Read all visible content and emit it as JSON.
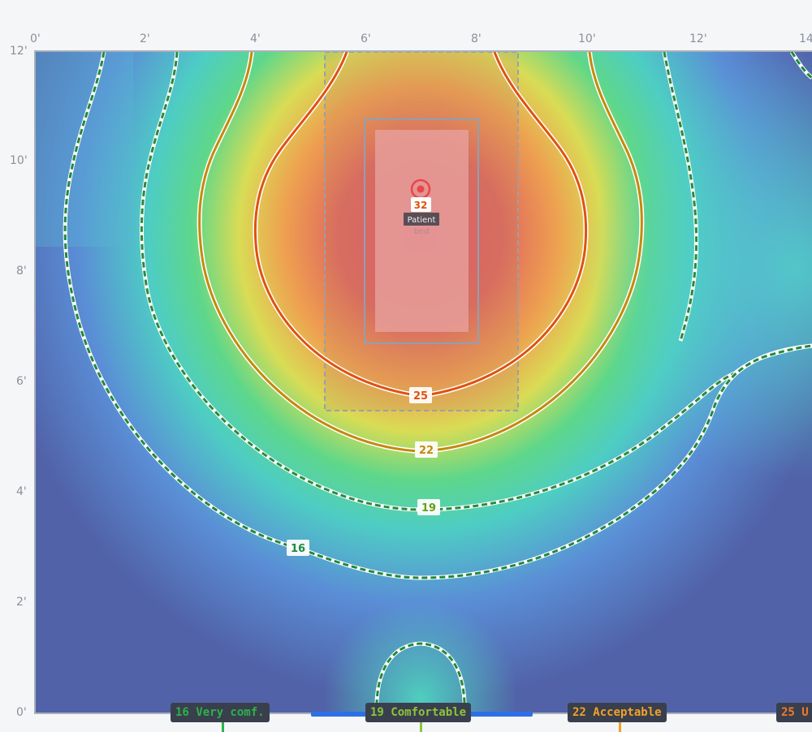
{
  "axis": {
    "x_ticks": [
      "0'",
      "2'",
      "4'",
      "6'",
      "8'",
      "10'",
      "12'",
      "14'"
    ],
    "y_ticks": [
      "12'",
      "10'",
      "8'",
      "6'",
      "4'",
      "2'",
      "0'"
    ]
  },
  "heat_source": {
    "value": "32",
    "label": "Patient",
    "sublabel": "bed",
    "marker_color": "#e8474a"
  },
  "contours": [
    {
      "value": "16",
      "label": "16",
      "color": "#1f8a3c",
      "dashed": true
    },
    {
      "value": "19",
      "label": "19",
      "color": "#6a9d1a",
      "dashed": true
    },
    {
      "value": "22",
      "label": "22",
      "color": "#c48a0c",
      "dashed": false
    },
    {
      "value": "25",
      "label": "25",
      "color": "#e0520e",
      "dashed": false
    }
  ],
  "legend": [
    {
      "label": "16 Very comf.",
      "color": "#2bb34a"
    },
    {
      "label": "19 Comfortable",
      "color": "#8bc63a"
    },
    {
      "label": "22 Acceptable",
      "color": "#f0a22b"
    },
    {
      "label": "25 U",
      "color": "#f07a2b"
    }
  ],
  "colors": {
    "background": "#f5f6f8",
    "frame": "#aab0ba",
    "comfort_bar": "#2d6fe6"
  }
}
